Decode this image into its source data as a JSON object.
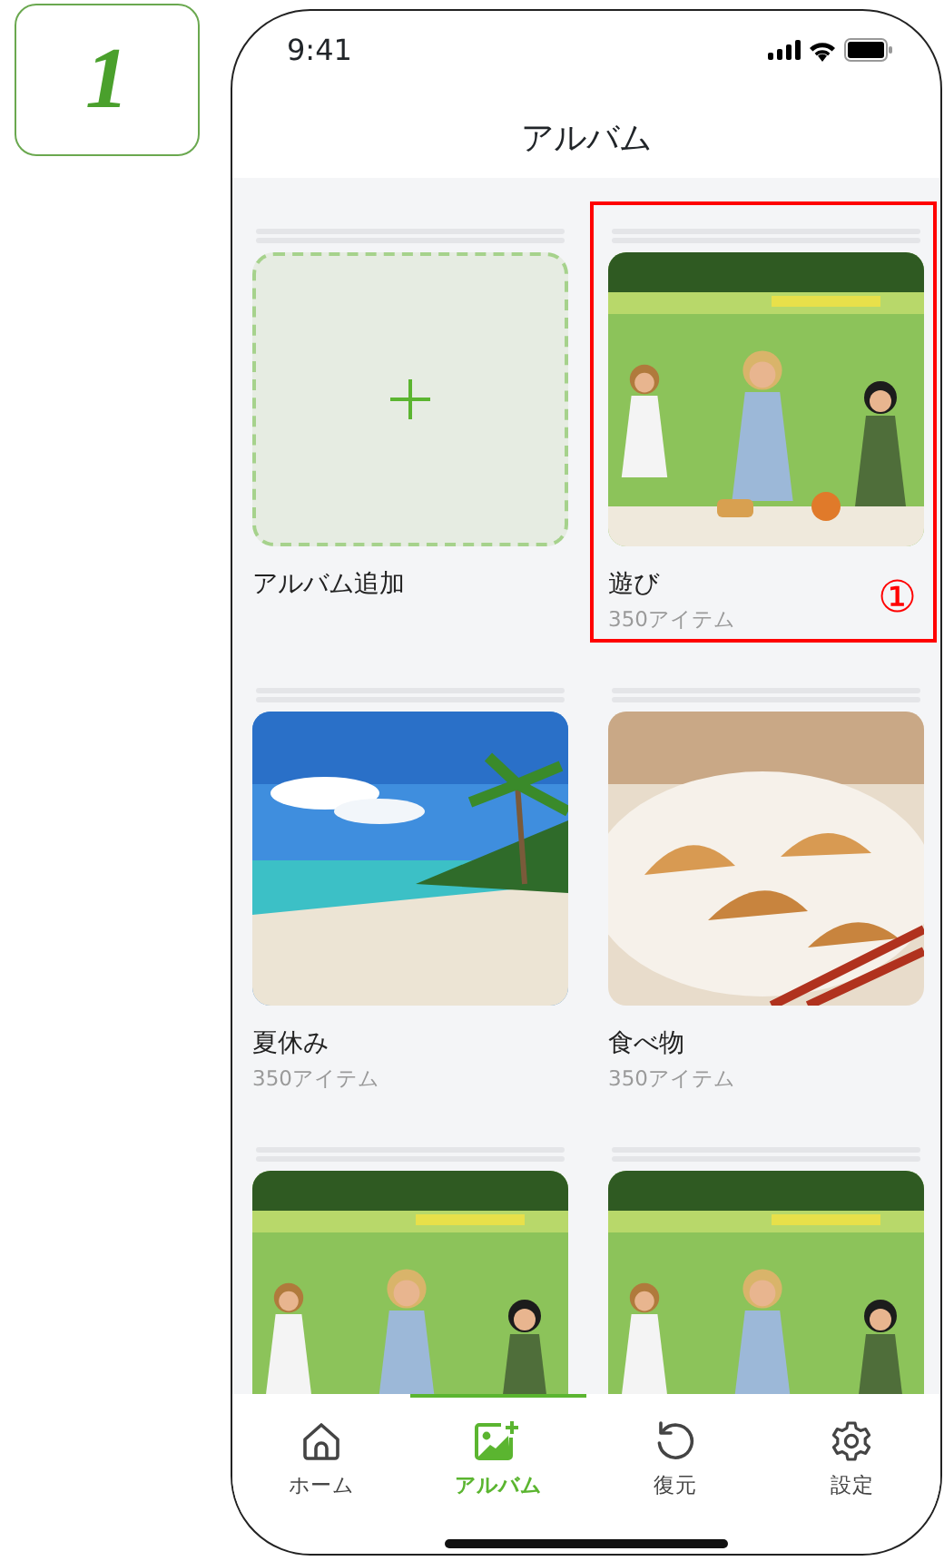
{
  "step_badge": "1",
  "status_bar": {
    "time": "9:41"
  },
  "header": {
    "title": "アルバム"
  },
  "add_album": {
    "label": "アルバム追加"
  },
  "albums": [
    {
      "title": "遊び",
      "count": "350アイテム",
      "highlighted": true,
      "callout": "①"
    },
    {
      "title": "夏休み",
      "count": "350アイテム",
      "highlighted": false
    },
    {
      "title": "食べ物",
      "count": "350アイテム",
      "highlighted": false
    },
    {
      "highlighted": false
    },
    {
      "highlighted": false
    }
  ],
  "tabs": [
    {
      "label": "ホーム",
      "selected": false
    },
    {
      "label": "アルバム",
      "selected": true
    },
    {
      "label": "復元",
      "selected": false
    },
    {
      "label": "設定",
      "selected": false
    }
  ]
}
